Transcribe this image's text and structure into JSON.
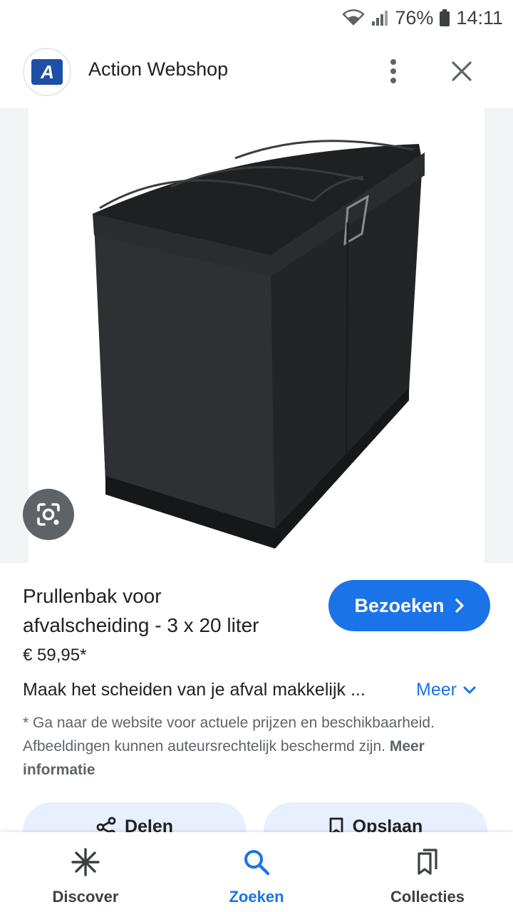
{
  "status_bar": {
    "battery": "76%",
    "time": "14:11",
    "icons": [
      "wifi-icon",
      "signal-icon",
      "battery-icon"
    ]
  },
  "header": {
    "logo_letter": "A",
    "title": "Action Webshop",
    "icons": [
      "more-vert-icon",
      "close-icon"
    ]
  },
  "image": {
    "subject": "black three-compartment waste bin",
    "lens_icon": "google-lens-icon"
  },
  "product": {
    "title_line1": "Prullenbak voor",
    "title_line2": "afvalscheiding - 3 x 20 liter",
    "price": "€ 59,95*",
    "description": "Maak het scheiden van je afval makkelijk ...",
    "more_label": "Meer"
  },
  "visit_button": {
    "label": "Bezoeken"
  },
  "disclaimer": {
    "text": "* Ga naar de website voor actuele prijzen en beschikbaarheid. Afbeeldingen kunnen auteursrechtelijk beschermd zijn.",
    "link": "Meer informatie"
  },
  "actions": {
    "share_label": "Delen",
    "save_label": "Opslaan"
  },
  "bottom_nav": {
    "items": [
      {
        "label": "Discover",
        "icon": "asterisk-icon",
        "active": false
      },
      {
        "label": "Zoeken",
        "icon": "search-icon",
        "active": true
      },
      {
        "label": "Collecties",
        "icon": "collections-icon",
        "active": false
      }
    ]
  },
  "colors": {
    "accent": "#1a73e8",
    "pill_bg": "#e8f0fe",
    "logo_blue": "#1d4fa6"
  }
}
